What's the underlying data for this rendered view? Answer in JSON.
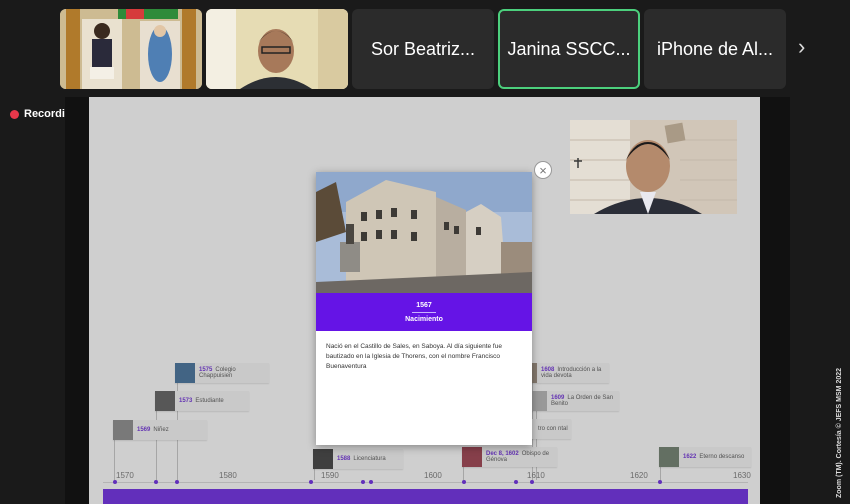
{
  "participants": [
    {
      "name": "",
      "kind": "video-shrine"
    },
    {
      "name": "",
      "kind": "video-person"
    },
    {
      "name": "Sor Beatriz...",
      "kind": "name"
    },
    {
      "name": "Janina SSCC...",
      "kind": "name",
      "active": true
    },
    {
      "name": "iPhone de Al...",
      "kind": "name"
    }
  ],
  "recording": {
    "label": "Recording"
  },
  "watermark": "Zoom (TM). Cortesía © JEFS MSM 2022",
  "timeline": {
    "axis_labels": [
      "1570",
      "1580",
      "1590",
      "1600",
      "1610",
      "1620",
      "1630"
    ],
    "events": [
      {
        "year": "1575",
        "label": "Colegio Chappuisien"
      },
      {
        "year": "1573",
        "label": "Estudiante"
      },
      {
        "year": "1569",
        "label": "Niñez"
      },
      {
        "year": "1588",
        "label": "Licenciatura"
      },
      {
        "year": "Dec 8, 1602",
        "label": "Obispo de Génova"
      },
      {
        "year": "1608",
        "label": "Introducción a la vida devota"
      },
      {
        "year": "1609",
        "label": "La Orden de San Benito"
      },
      {
        "year": "",
        "label": "tro con ntal"
      },
      {
        "year": "1622",
        "label": "Eterno descanso"
      }
    ]
  },
  "popup": {
    "year": "1567",
    "title": "Nacimiento",
    "text": "Nació en el Castillo de Sales, en Saboya. Al día siguiente fue bautizado en la Iglesia de Thorens, con el nombre Francisco Buenaventura"
  },
  "colors": {
    "accent": "#6514e6",
    "recording": "#e8374a",
    "active_border": "#4cd07d"
  }
}
